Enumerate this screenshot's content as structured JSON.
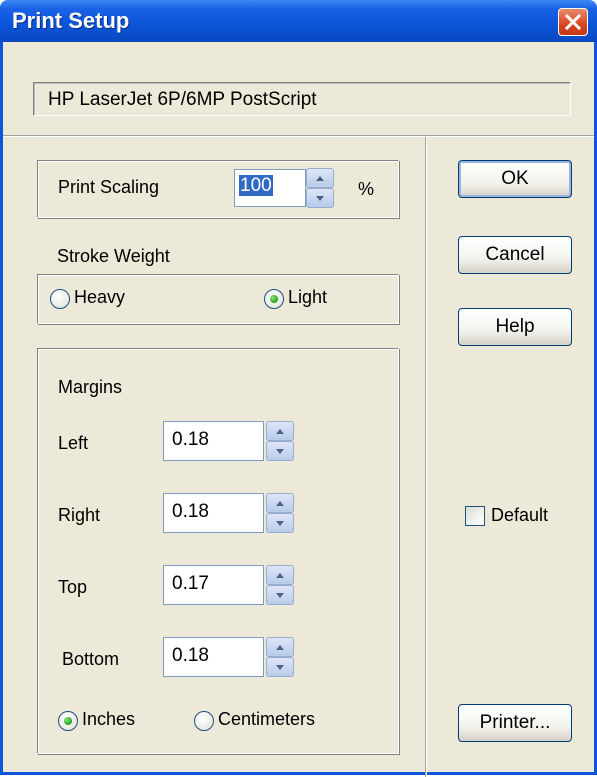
{
  "window": {
    "title": "Print Setup",
    "close_glyph": "✕"
  },
  "printer": {
    "name": "HP LaserJet 6P/6MP PostScript"
  },
  "scaling": {
    "label": "Print Scaling",
    "value": "100",
    "unit": "%"
  },
  "stroke": {
    "label": "Stroke Weight",
    "options": [
      {
        "label": "Heavy",
        "selected": false
      },
      {
        "label": "Light",
        "selected": true
      }
    ]
  },
  "margins": {
    "label": "Margins",
    "fields": [
      {
        "label": "Left",
        "value": "0.18"
      },
      {
        "label": "Right",
        "value": "0.18"
      },
      {
        "label": "Top",
        "value": "0.17"
      },
      {
        "label": "Bottom",
        "value": "0.18"
      }
    ],
    "units": [
      {
        "label": "Inches",
        "selected": true
      },
      {
        "label": "Centimeters",
        "selected": false
      }
    ]
  },
  "buttons": {
    "ok": "OK",
    "cancel": "Cancel",
    "help": "Help",
    "printer": "Printer..."
  },
  "default_checkbox": {
    "label": "Default",
    "checked": false
  },
  "icons": {
    "close": "close-icon",
    "spin_up": "spin-up-arrow-icon",
    "spin_down": "spin-down-arrow-icon"
  },
  "colors": {
    "titlebar": "#0a54d8",
    "dialog_face": "#ece9d8",
    "close_button": "#d9461f",
    "radio_dot": "#21a121",
    "selection": "#316ac5"
  }
}
